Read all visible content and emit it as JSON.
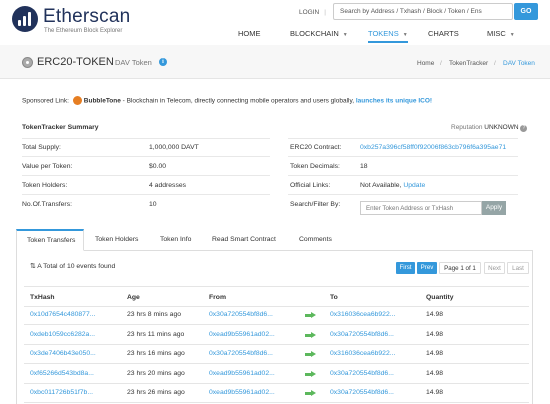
{
  "header": {
    "logo_text": "Etherscan",
    "logo_sub": "The Ethereum Block Explorer",
    "login": "LOGIN",
    "search_placeholder": "Search by Address / Txhash / Block / Token / Ens",
    "go": "GO",
    "nav": [
      "HOME",
      "BLOCKCHAIN",
      "TOKENS",
      "CHARTS",
      "MISC"
    ]
  },
  "title": {
    "main": "ERC20-TOKEN",
    "sub": "DAV Token",
    "breadcrumb": [
      "Home",
      "TokenTracker",
      "DAV Token"
    ]
  },
  "sponsored": {
    "label": "Sponsored Link:",
    "brand": "BubbleTone",
    "text": " - Blockchain in Telecom, directly connecting mobile operators and users globally, ",
    "cta": "launches its unique ICO!"
  },
  "summary": {
    "title": "TokenTracker Summary",
    "reputation_label": "Reputation",
    "reputation_value": "UNKNOWN",
    "left": [
      {
        "label": "Total Supply:",
        "value": "1,000,000 DAVT"
      },
      {
        "label": "Value per Token:",
        "value": "$0.00"
      },
      {
        "label": "Token Holders:",
        "value": "4 addresses"
      },
      {
        "label": "No.Of.Transfers:",
        "value": "10"
      }
    ],
    "right": [
      {
        "label": "ERC20 Contract:",
        "value": "0xb257a396cf58ff0f92006f863cb796f6a395ae71"
      },
      {
        "label": "Token Decimals:",
        "value": "18"
      },
      {
        "label": "Official Links:",
        "value": "Not Available, ",
        "link": "Update"
      },
      {
        "label": "Search/Filter By:",
        "value": ""
      }
    ],
    "filter_placeholder": "Enter Token Address or TxHash",
    "apply": "Apply"
  },
  "tabs": [
    "Token Transfers",
    "Token Holders",
    "Token Info",
    "Read Smart Contract",
    "Comments"
  ],
  "events": {
    "total": "A Total of 10 events found",
    "pager": {
      "first": "First",
      "prev": "Prev",
      "page": "Page 1 of 1",
      "next": "Next",
      "last": "Last"
    },
    "columns": [
      "TxHash",
      "Age",
      "From",
      "To",
      "Quantity"
    ],
    "rows": [
      {
        "txhash": "0x10d7654c480877...",
        "age": "23 hrs 8 mins ago",
        "from": "0x30a720554bf8d6...",
        "to": "0x316036cea6b922...",
        "qty": "14.98"
      },
      {
        "txhash": "0xdeb1059cc6282a...",
        "age": "23 hrs 11 mins ago",
        "from": "0xead9b55961ad02...",
        "to": "0x30a720554bf8d6...",
        "qty": "14.98"
      },
      {
        "txhash": "0x3de7406b43e050...",
        "age": "23 hrs 16 mins ago",
        "from": "0x30a720554bf8d6...",
        "to": "0x316036cea6b922...",
        "qty": "14.98"
      },
      {
        "txhash": "0xf65266d543bd8a...",
        "age": "23 hrs 20 mins ago",
        "from": "0xead9b55961ad02...",
        "to": "0x30a720554bf8d6...",
        "qty": "14.98"
      },
      {
        "txhash": "0xbc011726b51f7b...",
        "age": "23 hrs 26 mins ago",
        "from": "0xead9b55961ad02...",
        "to": "0x30a720554bf8d6...",
        "qty": "14.98"
      }
    ]
  }
}
